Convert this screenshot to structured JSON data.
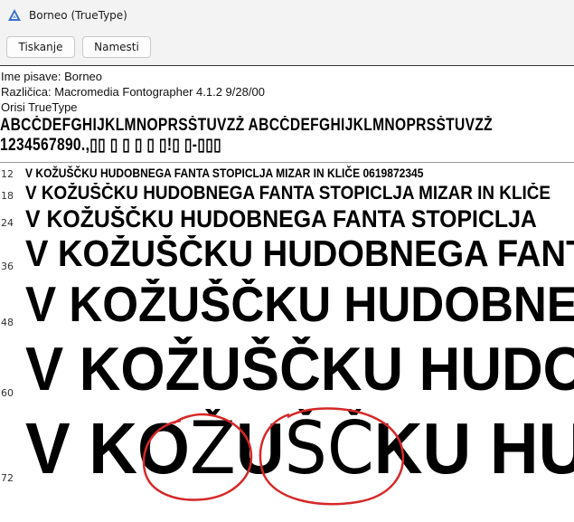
{
  "window": {
    "title": "Borneo (TrueType)"
  },
  "toolbar": {
    "print_label": "Tiskanje",
    "setup_label": "Namesti"
  },
  "info": {
    "name": "Ime pisave: Borneo",
    "version": "Različica: Macromedia Fontographer 4.1.2 9/28/00",
    "type": "Orisi TrueType"
  },
  "charset": {
    "line1": "ABCČDEFGHIJKLMNOPRSŠTUVZŽ ABCČDEFGHIJKLMNOPRSŠTUVZŽ",
    "line2": "1234567890.,▯▯ ▯ ▯ ▯ ▯ ▯!▯ ▯-▯▯▯"
  },
  "samples": [
    {
      "size": "12",
      "text": "V KOŽUŠČKU HUDOBNEGA FANTA STOPICLJA MIZAR IN KLIČE 0619872345"
    },
    {
      "size": "18",
      "text": "V KOŽUŠČKU HUDOBNEGA FANTA STOPICLJA MIZAR IN KLIČE"
    },
    {
      "size": "24",
      "text": "V KOŽUŠČKU HUDOBNEGA FANTA STOPICLJA"
    },
    {
      "size": "36",
      "text": "V KOŽUŠČKU HUDOBNEGA FANTA"
    },
    {
      "size": "48",
      "text": "V KOŽUŠČKU HUDOBNEGA"
    },
    {
      "size": "60",
      "text": "V KOŽUŠČKU HUDOB"
    },
    {
      "size": "72",
      "pre": "V KO",
      "ziv": "Ž",
      "u": "U",
      "sc": "ŠČ",
      "post": "KU HU"
    }
  ],
  "colors": {
    "annotation": "#d62828",
    "toolbar_bg": "#f3f3f3"
  }
}
